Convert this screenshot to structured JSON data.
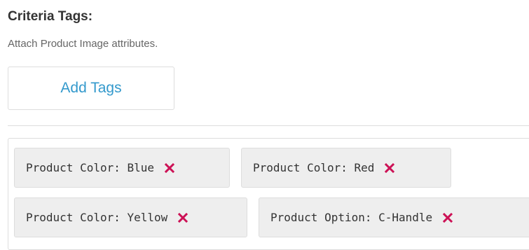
{
  "criteria": {
    "title": "Criteria Tags:",
    "subtitle": "Attach Product Image attributes.",
    "add_button_label": "Add Tags"
  },
  "tags": [
    {
      "label": "Product Color: Blue",
      "remove_icon": "close-icon"
    },
    {
      "label": "Product Color: Red",
      "remove_icon": "close-icon"
    },
    {
      "label": "Product Color: Yellow",
      "remove_icon": "close-icon"
    },
    {
      "label": "Product Option: C-Handle",
      "remove_icon": "close-icon"
    }
  ],
  "colors": {
    "accent": "#3399cc",
    "remove_icon": "#cc1155",
    "tag_background": "#eeeeee",
    "border": "#dddddd"
  }
}
